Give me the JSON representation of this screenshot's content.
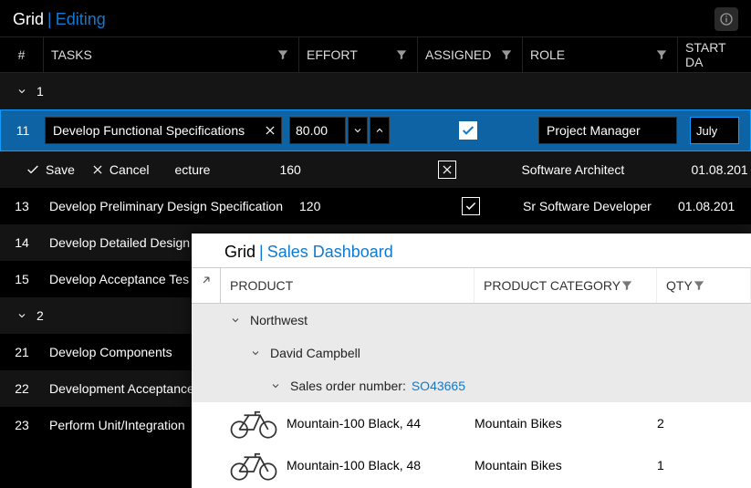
{
  "dark": {
    "title_grid": "Grid",
    "title_sub": "Editing",
    "columns": {
      "num": "#",
      "tasks": "TASKS",
      "effort": "EFFORT",
      "assigned": "ASSIGNED",
      "role": "ROLE",
      "start": "START DA"
    },
    "group1": "1",
    "group2": "2",
    "editing": {
      "row_num": "11",
      "task_value": "Develop Functional Specifications",
      "effort_value": "80.00",
      "role_value": "Project Manager",
      "date_value": "July"
    },
    "actions": {
      "save": "Save",
      "cancel": "Cancel"
    },
    "rows": [
      {
        "num": "",
        "task_tail": "ecture",
        "effort": "160",
        "assigned": "x",
        "role": "Software Architect",
        "start": "01.08.201"
      },
      {
        "num": "13",
        "task": "Develop Preliminary Design Specification",
        "effort": "120",
        "assigned": "check",
        "role": "Sr Software Developer",
        "start": "01.08.201"
      },
      {
        "num": "14",
        "task": "Develop Detailed Design",
        "effort": "",
        "assigned": "",
        "role": "",
        "start": ""
      },
      {
        "num": "15",
        "task": "Develop Acceptance Tes",
        "effort": "",
        "assigned": "",
        "role": "",
        "start": ""
      },
      {
        "num": "21",
        "task": "Develop Components",
        "effort": "",
        "assigned": "",
        "role": "",
        "start": ""
      },
      {
        "num": "22",
        "task": "Development Acceptance",
        "effort": "",
        "assigned": "",
        "role": "",
        "start": ""
      },
      {
        "num": "23",
        "task": "Perform Unit/Integration",
        "effort": "",
        "assigned": "",
        "role": "",
        "start": ""
      }
    ]
  },
  "light": {
    "title_grid": "Grid",
    "title_sub": "Sales Dashboard",
    "columns": {
      "product": "PRODUCT",
      "category": "PRODUCT CATEGORY",
      "qty": "QTY"
    },
    "groups": {
      "region": "Northwest",
      "person": "David Campbell",
      "order_label": "Sales order number:",
      "order_value": "SO43665"
    },
    "rows": [
      {
        "product": "Mountain-100 Black, 44",
        "category": "Mountain Bikes",
        "qty": "2"
      },
      {
        "product": "Mountain-100 Black, 48",
        "category": "Mountain Bikes",
        "qty": "1"
      }
    ]
  }
}
